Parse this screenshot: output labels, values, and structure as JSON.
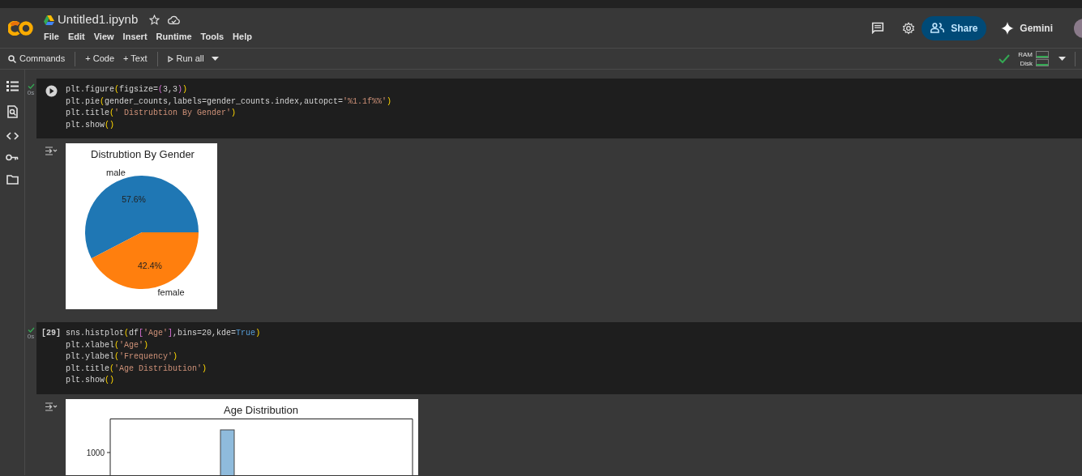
{
  "header": {
    "title": "Untitled1.ipynb",
    "menu": [
      "File",
      "Edit",
      "View",
      "Insert",
      "Runtime",
      "Tools",
      "Help"
    ],
    "share": "Share",
    "gemini": "Gemini"
  },
  "toolbar": {
    "commands": "Commands",
    "add_code": "+ Code",
    "add_text": "+ Text",
    "run_all": "Run all",
    "connected": true,
    "ram": "RAM",
    "disk": "Disk"
  },
  "cells": [
    {
      "executed": true,
      "time": "0s",
      "lines": [
        [
          {
            "text": "plt.figure",
            "kind": "plain"
          },
          {
            "text": "(",
            "kind": "bracket"
          },
          {
            "text": "figsize=",
            "kind": "plain"
          },
          {
            "text": "(",
            "kind": "bracket2"
          },
          {
            "text": "3,3",
            "kind": "plain"
          },
          {
            "text": ")",
            "kind": "bracket2"
          },
          {
            "text": ")",
            "kind": "bracket"
          }
        ],
        [
          {
            "text": "plt.pie",
            "kind": "plain"
          },
          {
            "text": "(",
            "kind": "bracket"
          },
          {
            "text": "gender_counts,labels=gender_counts.index,autopct=",
            "kind": "plain"
          },
          {
            "text": "'%1.1f%%'",
            "kind": "string"
          },
          {
            "text": ")",
            "kind": "bracket"
          }
        ],
        [
          {
            "text": "plt.title",
            "kind": "plain"
          },
          {
            "text": "(",
            "kind": "bracket"
          },
          {
            "text": "' Distrubtion By Gender'",
            "kind": "string"
          },
          {
            "text": ")",
            "kind": "bracket"
          }
        ],
        [
          {
            "text": "plt.show",
            "kind": "plain"
          },
          {
            "text": "()",
            "kind": "bracket"
          }
        ]
      ],
      "output": {
        "kind": "pie",
        "chart_data": {
          "type": "pie",
          "title": "Distrubtion By Gender",
          "categories": [
            "male",
            "female"
          ],
          "values": [
            57.6,
            42.4
          ],
          "value_labels": [
            "57.6%",
            "42.4%"
          ]
        }
      }
    },
    {
      "executed": true,
      "time": "0s",
      "exec_count": "[29]",
      "lines": [
        [
          {
            "text": "sns.histplot",
            "kind": "plain"
          },
          {
            "text": "(",
            "kind": "bracket"
          },
          {
            "text": "df",
            "kind": "plain"
          },
          {
            "text": "[",
            "kind": "bracket2"
          },
          {
            "text": "'Age'",
            "kind": "string"
          },
          {
            "text": "]",
            "kind": "bracket2"
          },
          {
            "text": ",bins=20,kde=",
            "kind": "plain"
          },
          {
            "text": "True",
            "kind": "keyword"
          },
          {
            "text": ")",
            "kind": "bracket"
          }
        ],
        [
          {
            "text": "plt.xlabel",
            "kind": "plain"
          },
          {
            "text": "(",
            "kind": "bracket"
          },
          {
            "text": "'Age'",
            "kind": "string"
          },
          {
            "text": ")",
            "kind": "bracket"
          }
        ],
        [
          {
            "text": "plt.ylabel",
            "kind": "plain"
          },
          {
            "text": "(",
            "kind": "bracket"
          },
          {
            "text": "'Frequency'",
            "kind": "string"
          },
          {
            "text": ")",
            "kind": "bracket"
          }
        ],
        [
          {
            "text": "plt.title",
            "kind": "plain"
          },
          {
            "text": "(",
            "kind": "bracket"
          },
          {
            "text": "'Age Distribution'",
            "kind": "string"
          },
          {
            "text": ")",
            "kind": "bracket"
          }
        ],
        [
          {
            "text": "plt.show",
            "kind": "plain"
          },
          {
            "text": "()",
            "kind": "bracket"
          }
        ]
      ],
      "output": {
        "kind": "hist",
        "title": "Age Distribution",
        "ytick": "1000"
      }
    }
  ]
}
